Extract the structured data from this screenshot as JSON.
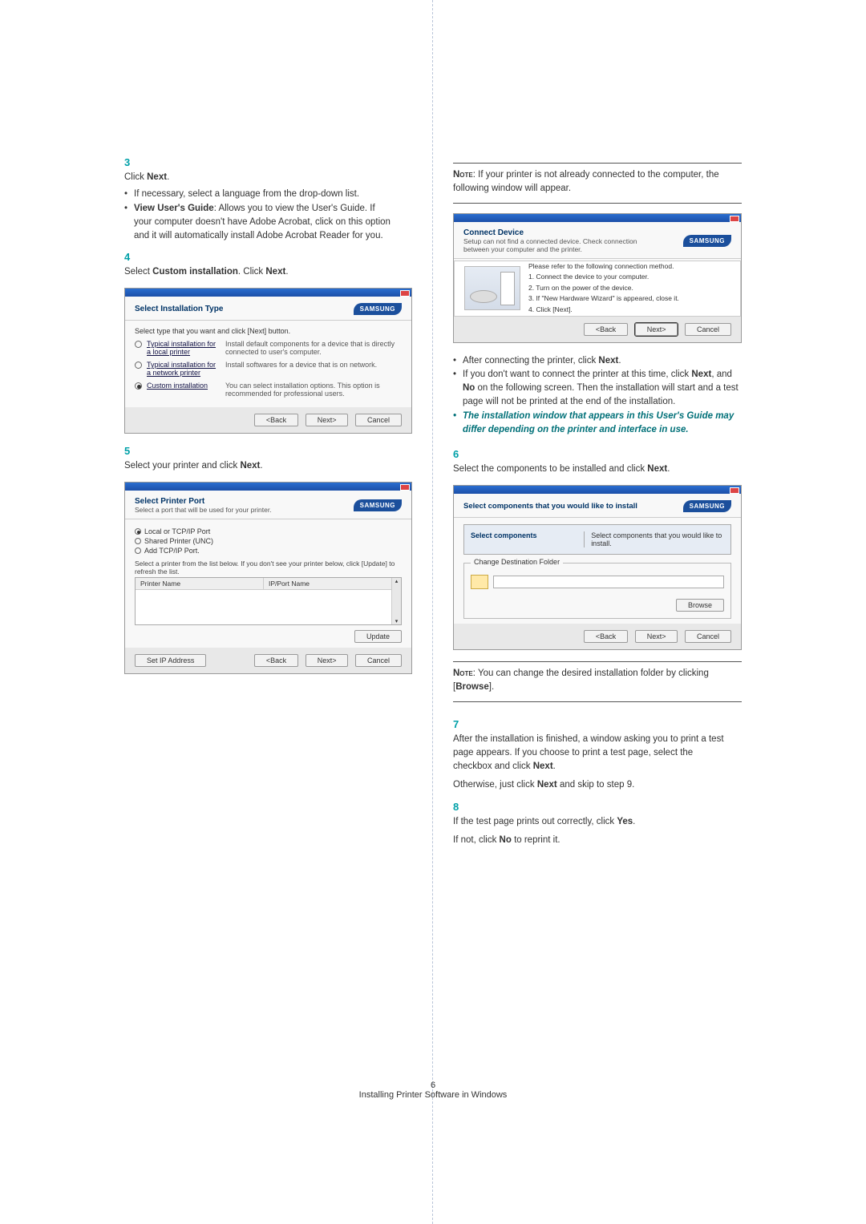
{
  "leftColumn": {
    "step3": {
      "num": "3",
      "text_a": "Click ",
      "text_b": "Next",
      "text_c": ".",
      "bullet1": "If necessary, select a language from the drop-down list.",
      "bullet2_a": "View User's Guide",
      "bullet2_b": ": Allows you to view the User's Guide. If your computer doesn't have Adobe Acrobat, click on this option and it will automatically install Adobe Acrobat Reader for you."
    },
    "step4": {
      "num": "4",
      "text_a": "Select ",
      "text_b": "Custom installation",
      "text_c": ". Click ",
      "text_d": "Next",
      "text_e": "."
    },
    "fig1": {
      "title": "Select Installation Type",
      "brand": "SAMSUNG",
      "subtitle": "Select type that you want and click [Next] button.",
      "row1_label": "Typical installation for a local printer",
      "row1_desc": "Install default components for a device that is directly connected to user's computer.",
      "row2_label": "Typical installation for a network printer",
      "row2_desc": "Install softwares for a device that is on network.",
      "row3_label": "Custom installation",
      "row3_desc": "You can select installation options. This option is recommended for professional users.",
      "btn_back": "<Back",
      "btn_next": "Next>",
      "btn_cancel": "Cancel"
    },
    "step5": {
      "num": "5",
      "text_a": "Select your printer and click ",
      "text_b": "Next",
      "text_c": "."
    },
    "fig2": {
      "title": "Select Printer Port",
      "brand": "SAMSUNG",
      "subtitle": "Select a port that will be used for your printer.",
      "opt1": "Local or TCP/IP Port",
      "opt2": "Shared Printer (UNC)",
      "opt3": "Add TCP/IP Port.",
      "hint": "Select a printer from the list below. If you don't see your printer below, click [Update] to refresh the list.",
      "colA": "Printer Name",
      "colB": "IP/Port Name",
      "btn_update": "Update",
      "btn_setip": "Set IP Address",
      "btn_back": "<Back",
      "btn_next": "Next>",
      "btn_cancel": "Cancel"
    }
  },
  "rightColumn": {
    "note1_a": "Note",
    "note1_b": ": If your printer is not already connected to the computer, the following window will appear.",
    "fig3": {
      "title": "Connect Device",
      "brand": "SAMSUNG",
      "subtitle": "Setup can not find a connected device. Check connection between your computer and the printer.",
      "intro": "Please refer to the following connection method.",
      "s1": "1. Connect the device to your computer.",
      "s2": "2. Turn on the power of the device.",
      "s3": "3. If \"New Hardware Wizard\" is appeared, close it.",
      "s4": "4. Click [Next].",
      "btn_back": "<Back",
      "btn_next": "Next>",
      "btn_cancel": "Cancel"
    },
    "bullet1_a": "After connecting the printer, click ",
    "bullet1_b": "Next",
    "bullet1_c": ".",
    "bullet2_a": "If you don't want to connect the printer at this time, click ",
    "bullet2_b": "Next",
    "bullet2_c": ", and ",
    "bullet2_d": "No",
    "bullet2_e": " on the following screen. Then the installation will start and a test page will not be printed at the end of the installation.",
    "bullet3": "The installation window that appears in this User's Guide may differ depending on the printer and interface in use.",
    "step6": {
      "num": "6",
      "text_a": "Select the components to be installed and click ",
      "text_b": "Next",
      "text_c": "."
    },
    "fig4": {
      "title": "Select components that you would like to install",
      "brand": "SAMSUNG",
      "left_label": "Select components",
      "right_label": "Select components that you would like to install.",
      "legend": "Change Destination Folder",
      "btn_browse": "Browse",
      "btn_back": "<Back",
      "btn_next": "Next>",
      "btn_cancel": "Cancel"
    },
    "note2_a": "Note",
    "note2_b": ": You can change the desired installation folder by clicking [",
    "note2_c": "Browse",
    "note2_d": "].",
    "step7": {
      "num": "7",
      "text_a": "After the installation is finished, a window asking you to print a test page appears. If you choose to print a test page, select the checkbox and click ",
      "text_b": "Next",
      "text_c": ".",
      "text_d": "Otherwise, just click ",
      "text_e": "Next",
      "text_f": " and skip to step 9."
    },
    "step8": {
      "num": "8",
      "text_a": "If the test page prints out correctly, click ",
      "text_b": "Yes",
      "text_c": ".",
      "text_d": "If not, click ",
      "text_e": "No",
      "text_f": " to reprint it."
    }
  },
  "footer": {
    "pagenum": "6",
    "caption": "Installing Printer Software in Windows"
  }
}
